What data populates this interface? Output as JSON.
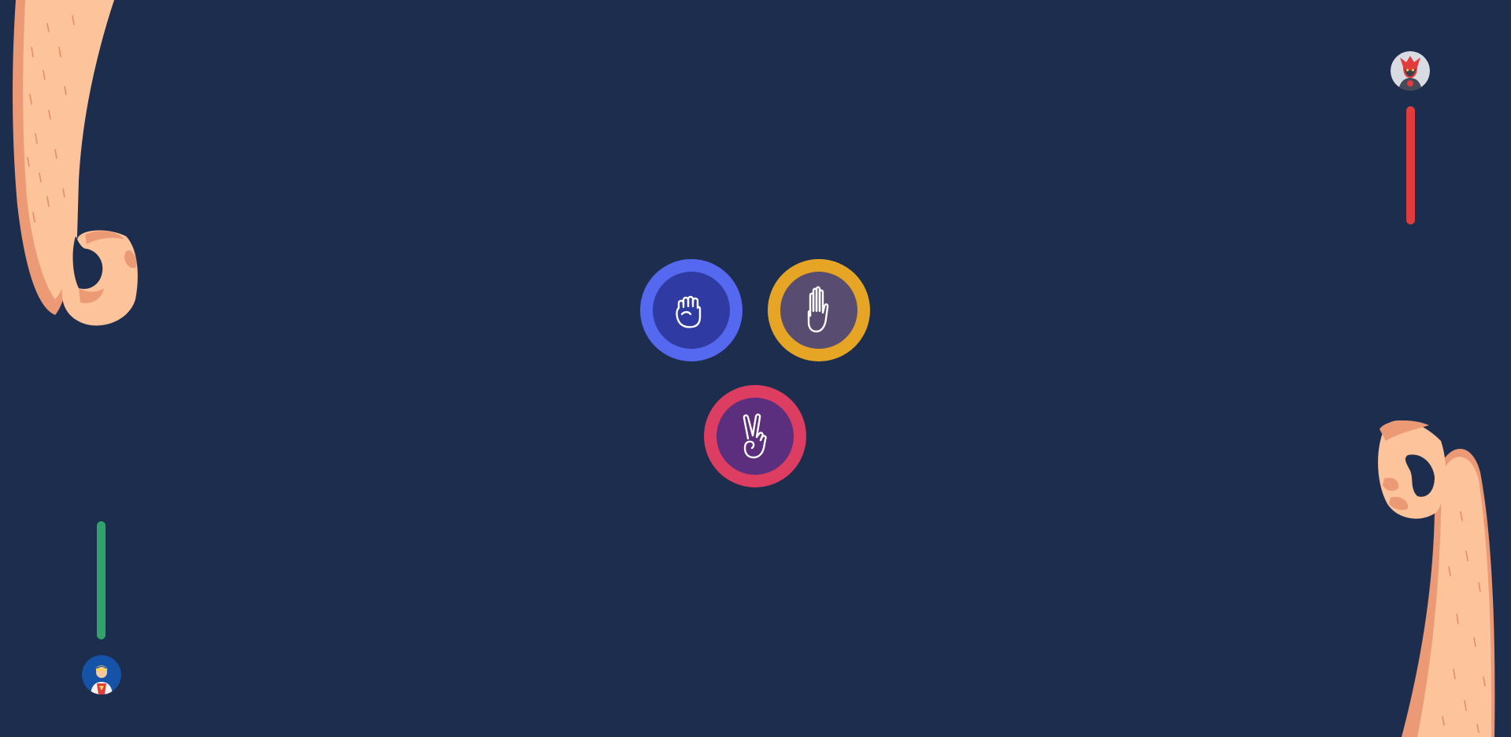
{
  "game": {
    "background_color": "#1c2d4d",
    "choices": [
      {
        "id": "rock",
        "icon": "fist-icon",
        "ring_color": "#5468f0",
        "inner_color": "#2f3aa3"
      },
      {
        "id": "paper",
        "icon": "open-hand-icon",
        "ring_color": "#e6a525",
        "inner_color": "#584c70"
      },
      {
        "id": "scissors",
        "icon": "peace-sign-icon",
        "ring_color": "#dd3d60",
        "inner_color": "#5b2e7e"
      }
    ],
    "player": {
      "avatar_icon": "superhero-avatar-icon",
      "health_color": "#2fa36a",
      "health_level": 1.0
    },
    "opponent": {
      "avatar_icon": "villain-avatar-icon",
      "health_color": "#e03c3c",
      "health_level": 1.0
    },
    "hands": {
      "player_hand_icon": "ok-hand-gesture-icon",
      "opponent_hand_icon": "ok-hand-gesture-icon",
      "skin_color": "#fdc39b",
      "shadow_color": "#ec9a76"
    }
  }
}
